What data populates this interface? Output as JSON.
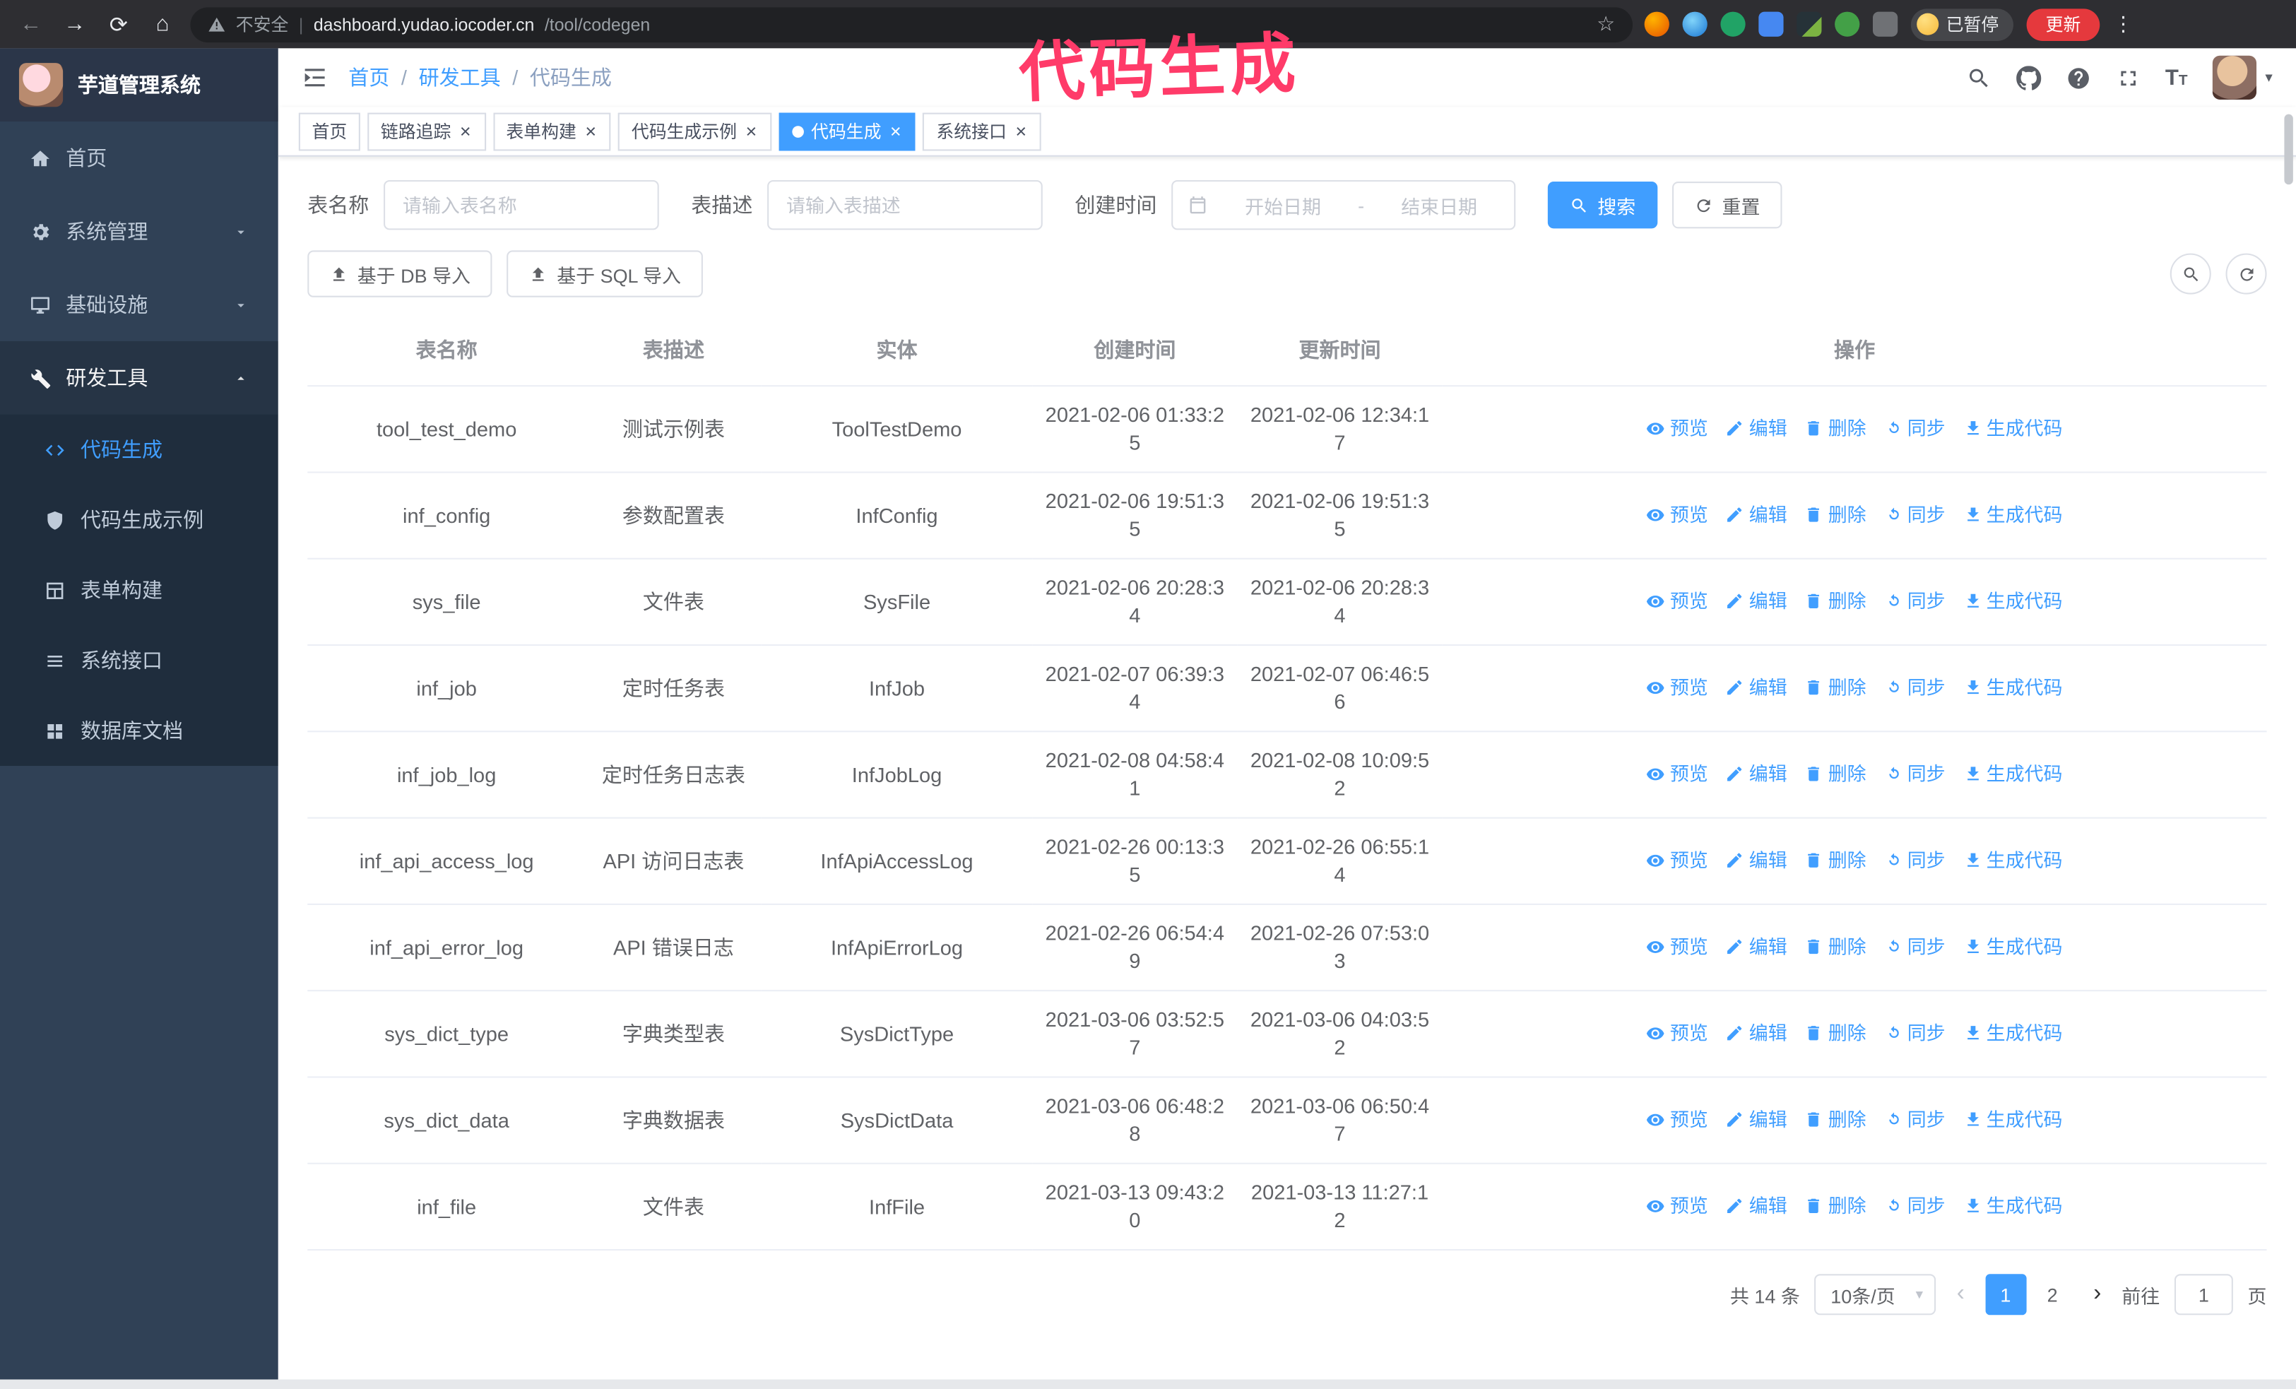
{
  "annotation": "代码生成",
  "browser": {
    "security_label": "不安全",
    "url_host": "dashboard.yudao.iocoder.cn",
    "url_path": "/tool/codegen",
    "paused_badge": "已暂停",
    "update_button": "更新"
  },
  "sidebar": {
    "logo_title": "芋道管理系统",
    "items": [
      {
        "id": "home",
        "icon": "home",
        "label": "首页"
      },
      {
        "id": "system",
        "icon": "gear",
        "label": "系统管理",
        "chevron": "down"
      },
      {
        "id": "infra",
        "icon": "monitor",
        "label": "基础设施",
        "chevron": "down"
      },
      {
        "id": "devtools",
        "icon": "wrench",
        "label": "研发工具",
        "chevron": "up",
        "children": [
          {
            "id": "codegen",
            "icon": "code",
            "label": "代码生成",
            "active": true
          },
          {
            "id": "codegen-example",
            "icon": "shield",
            "label": "代码生成示例"
          },
          {
            "id": "form-builder",
            "icon": "table",
            "label": "表单构建"
          },
          {
            "id": "api",
            "icon": "list",
            "label": "系统接口"
          },
          {
            "id": "db-doc",
            "icon": "grid",
            "label": "数据库文档"
          }
        ]
      }
    ]
  },
  "header": {
    "breadcrumb": [
      "首页",
      "研发工具",
      "代码生成"
    ]
  },
  "tabs": [
    {
      "id": "home",
      "label": "首页",
      "closable": false,
      "active": false
    },
    {
      "id": "trace",
      "label": "链路追踪",
      "closable": true,
      "active": false
    },
    {
      "id": "form-builder",
      "label": "表单构建",
      "closable": true,
      "active": false
    },
    {
      "id": "codegen-example",
      "label": "代码生成示例",
      "closable": true,
      "active": false
    },
    {
      "id": "codegen",
      "label": "代码生成",
      "closable": true,
      "active": true
    },
    {
      "id": "api",
      "label": "系统接口",
      "closable": true,
      "active": false
    }
  ],
  "filters": {
    "table_name_label": "表名称",
    "table_name_placeholder": "请输入表名称",
    "table_desc_label": "表描述",
    "table_desc_placeholder": "请输入表描述",
    "create_time_label": "创建时间",
    "date_start_placeholder": "开始日期",
    "date_separator": "-",
    "date_end_placeholder": "结束日期",
    "search_button": "搜索",
    "reset_button": "重置"
  },
  "toolbar": {
    "import_db": "基于 DB 导入",
    "import_sql": "基于 SQL 导入"
  },
  "table": {
    "columns": [
      "表名称",
      "表描述",
      "实体",
      "创建时间",
      "更新时间",
      "操作"
    ],
    "actions": [
      "预览",
      "编辑",
      "删除",
      "同步",
      "生成代码"
    ],
    "action_ids": [
      "preview",
      "edit",
      "delete",
      "sync",
      "generate"
    ],
    "action_icons": [
      "eye",
      "edit",
      "trash",
      "sync",
      "download"
    ],
    "rows": [
      {
        "name": "tool_test_demo",
        "desc": "测试示例表",
        "entity": "ToolTestDemo",
        "created": "2021-02-06 01:33:25",
        "updated": "2021-02-06 12:34:17"
      },
      {
        "name": "inf_config",
        "desc": "参数配置表",
        "entity": "InfConfig",
        "created": "2021-02-06 19:51:35",
        "updated": "2021-02-06 19:51:35"
      },
      {
        "name": "sys_file",
        "desc": "文件表",
        "entity": "SysFile",
        "created": "2021-02-06 20:28:34",
        "updated": "2021-02-06 20:28:34"
      },
      {
        "name": "inf_job",
        "desc": "定时任务表",
        "entity": "InfJob",
        "created": "2021-02-07 06:39:34",
        "updated": "2021-02-07 06:46:56"
      },
      {
        "name": "inf_job_log",
        "desc": "定时任务日志表",
        "entity": "InfJobLog",
        "created": "2021-02-08 04:58:41",
        "updated": "2021-02-08 10:09:52"
      },
      {
        "name": "inf_api_access_log",
        "desc": "API 访问日志表",
        "entity": "InfApiAccessLog",
        "created": "2021-02-26 00:13:35",
        "updated": "2021-02-26 06:55:14"
      },
      {
        "name": "inf_api_error_log",
        "desc": "API 错误日志",
        "entity": "InfApiErrorLog",
        "created": "2021-02-26 06:54:49",
        "updated": "2021-02-26 07:53:03"
      },
      {
        "name": "sys_dict_type",
        "desc": "字典类型表",
        "entity": "SysDictType",
        "created": "2021-03-06 03:52:57",
        "updated": "2021-03-06 04:03:52"
      },
      {
        "name": "sys_dict_data",
        "desc": "字典数据表",
        "entity": "SysDictData",
        "created": "2021-03-06 06:48:28",
        "updated": "2021-03-06 06:50:47"
      },
      {
        "name": "inf_file",
        "desc": "文件表",
        "entity": "InfFile",
        "created": "2021-03-13 09:43:20",
        "updated": "2021-03-13 11:27:12"
      }
    ]
  },
  "pagination": {
    "total": "共 14 条",
    "page_size": "10条/页",
    "pages": [
      "1",
      "2"
    ],
    "active_page": "1",
    "goto_label": "前往",
    "goto_value": "1",
    "goto_suffix": "页"
  },
  "colors": {
    "accent": "#409eff",
    "annotation": "#ff3b69",
    "sidebar_bg": "#304156",
    "sidebar_submenu_bg": "#1f2d3d"
  }
}
